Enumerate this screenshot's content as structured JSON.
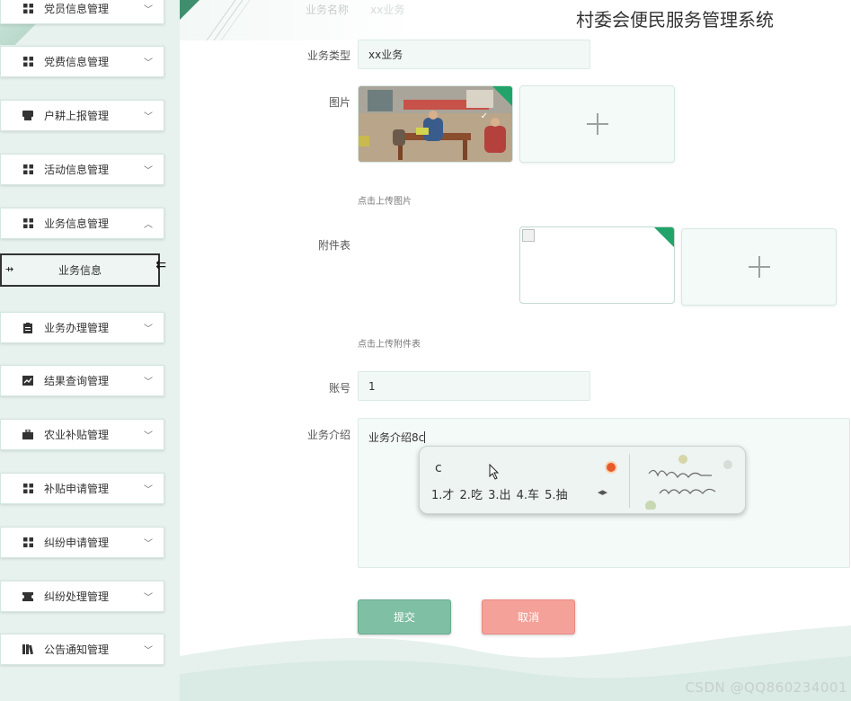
{
  "app_title": "村委会便民服务管理系统",
  "faded_top": {
    "label": "业务名称",
    "value": "xx业务"
  },
  "sidebar": {
    "items": [
      {
        "label": "党员信息管理",
        "icon": "grid-icon"
      },
      {
        "label": "党费信息管理",
        "icon": "grid-icon"
      },
      {
        "label": "户耕上报管理",
        "icon": "printer-icon"
      },
      {
        "label": "活动信息管理",
        "icon": "grid-icon"
      },
      {
        "label": "业务信息管理",
        "icon": "grid-icon",
        "expanded": true
      },
      {
        "label": "业务办理管理",
        "icon": "clipboard-icon"
      },
      {
        "label": "结果查询管理",
        "icon": "chart-icon"
      },
      {
        "label": "农业补贴管理",
        "icon": "briefcase-icon"
      },
      {
        "label": "补贴申请管理",
        "icon": "grid-icon"
      },
      {
        "label": "纠纷申请管理",
        "icon": "grid-icon"
      },
      {
        "label": "纠纷处理管理",
        "icon": "ticket-icon"
      },
      {
        "label": "公告通知管理",
        "icon": "library-icon"
      }
    ],
    "active_sub": "业务信息"
  },
  "form": {
    "type_label": "业务类型",
    "type_value": "xx业务",
    "image_label": "图片",
    "image_hint": "点击上传图片",
    "attachment_label": "附件表",
    "attachment_hint": "点击上传附件表",
    "account_label": "账号",
    "account_value": "1",
    "intro_label": "业务介绍",
    "intro_value": "业务介绍8c"
  },
  "ime": {
    "typed": "c",
    "candidates": "1.才  2.吃  3.出  4.车  5.抽"
  },
  "buttons": {
    "submit": "提交",
    "cancel": "取消"
  },
  "watermark": "CSDN @QQ860234001",
  "colors": {
    "accent": "#22a36a",
    "submit": "#7fbfa3",
    "cancel": "#f4a19a"
  }
}
